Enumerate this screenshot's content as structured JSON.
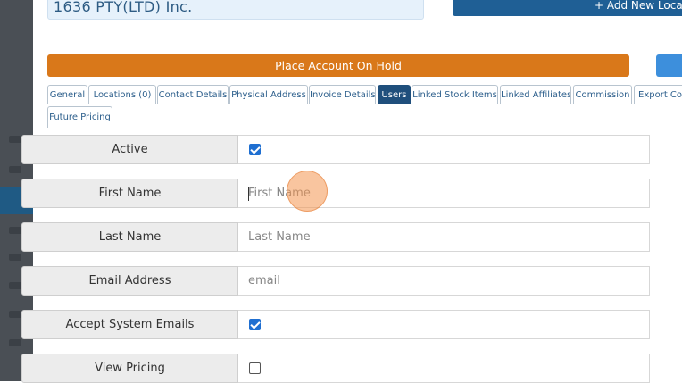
{
  "header": {
    "company_name": "1636 PTY(LTD) Inc.",
    "add_location_label": "+ Add New Location"
  },
  "hold_button_label": "Place Account On Hold",
  "tabs": [
    {
      "label": "General",
      "active": false
    },
    {
      "label": "Locations (0)",
      "active": false
    },
    {
      "label": "Contact Details",
      "active": false
    },
    {
      "label": "Physical Address",
      "active": false
    },
    {
      "label": "Invoice Details",
      "active": false
    },
    {
      "label": "Users",
      "active": true
    },
    {
      "label": "Linked Stock Items",
      "active": false
    },
    {
      "label": "Linked Affiliates",
      "active": false
    },
    {
      "label": "Commission",
      "active": false
    },
    {
      "label": "Export Con",
      "active": false
    },
    {
      "label": "Future Pricing",
      "active": false
    }
  ],
  "form": {
    "active": {
      "label": "Active",
      "checked": true
    },
    "first_name": {
      "label": "First Name",
      "placeholder": "First Name",
      "value": ""
    },
    "last_name": {
      "label": "Last Name",
      "placeholder": "Last Name",
      "value": ""
    },
    "email": {
      "label": "Email Address",
      "placeholder": "email",
      "value": ""
    },
    "accept_emails": {
      "label": "Accept System Emails",
      "checked": true
    },
    "view_pricing": {
      "label": "View Pricing",
      "checked": false
    }
  },
  "colors": {
    "accent_blue": "#1f4f7c",
    "hold_orange": "#d9781a",
    "checkbox_blue": "#1f6fd1"
  }
}
